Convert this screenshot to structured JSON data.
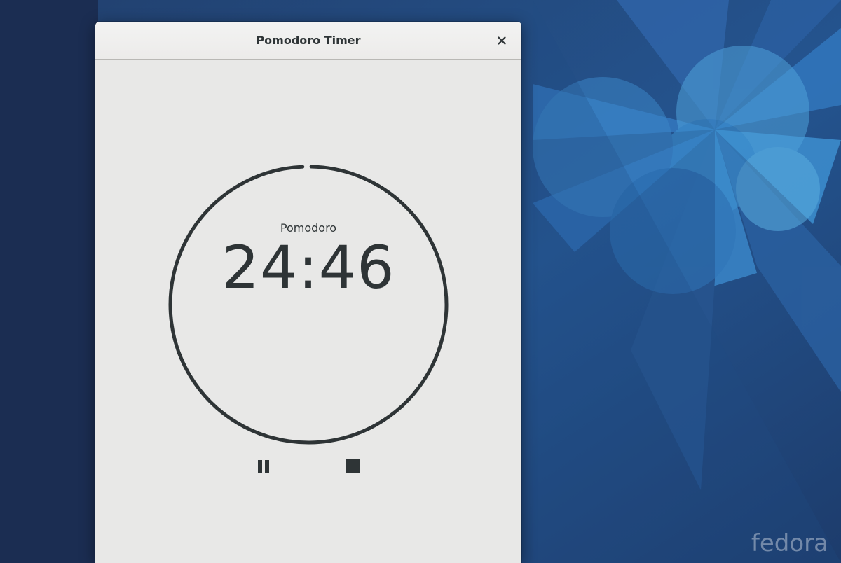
{
  "window": {
    "title": "Pomodoro Timer"
  },
  "timer": {
    "state_label": "Pomodoro",
    "time_remaining": "24:46",
    "progress_remaining_fraction": 0.99
  },
  "controls": {
    "pause_icon": "pause-icon",
    "stop_icon": "stop-icon",
    "close_icon": "close-icon"
  },
  "desktop": {
    "watermark": "fedora"
  },
  "colors": {
    "window_bg": "#e8e8e7",
    "foreground": "#2e3436",
    "desktop_bg": "#1c2f55",
    "accent_blue": "#3a8fd0"
  }
}
